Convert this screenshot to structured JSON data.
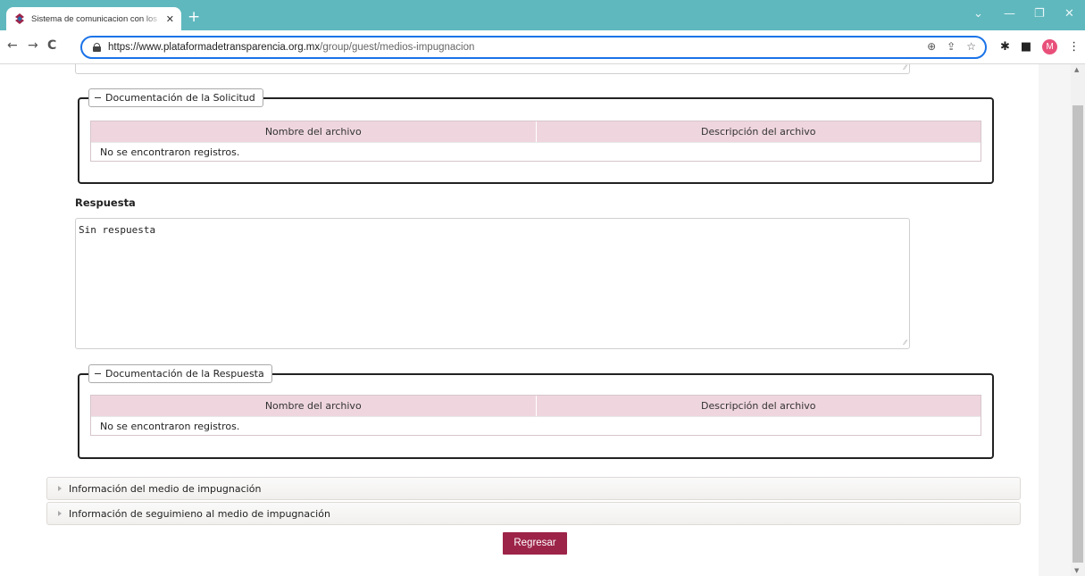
{
  "browser": {
    "tab_title": "Sistema de comunicacion con los",
    "tab_close": "✕",
    "new_tab": "+",
    "url_host": "https://www.plataformadetransparencia.org.mx",
    "url_path": "/group/guest/medios-impugnacion",
    "avatar_letter": "M",
    "icons": [
      "search-icon",
      "share-icon",
      "star-icon",
      "puzzle-icon",
      "sidepanel-icon",
      "menu-icon"
    ]
  },
  "solicitud_docs": {
    "legend": "Documentación de la Solicitud",
    "columns": [
      "Nombre del archivo",
      "Descripción del archivo"
    ],
    "empty_message": "No se encontraron registros."
  },
  "respuesta": {
    "label": "Respuesta",
    "value": "Sin respuesta"
  },
  "respuesta_docs": {
    "legend": "Documentación de la Respuesta",
    "columns": [
      "Nombre del archivo",
      "Descripción del archivo"
    ],
    "empty_message": "No se encontraron registros."
  },
  "accordions": [
    {
      "label": "Información del medio de impugnación"
    },
    {
      "label": "Información de seguimieno al medio de impugnación"
    }
  ],
  "actions": {
    "back_label": "Regresar"
  },
  "colors": {
    "tabbar": "#5fb8be",
    "grid_header": "#efd6de",
    "button": "#9d2449"
  }
}
